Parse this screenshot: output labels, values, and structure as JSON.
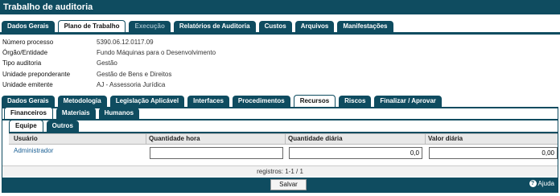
{
  "window": {
    "title": "Trabalho de auditoria"
  },
  "main_tabs": [
    {
      "label": "Dados Gerais",
      "state": "normal"
    },
    {
      "label": "Plano de Trabalho",
      "state": "active"
    },
    {
      "label": "Execução",
      "state": "disabled"
    },
    {
      "label": "Relatórios de Auditoria",
      "state": "normal"
    },
    {
      "label": "Custos",
      "state": "normal"
    },
    {
      "label": "Arquivos",
      "state": "normal"
    },
    {
      "label": "Manifestações",
      "state": "normal"
    }
  ],
  "info": [
    {
      "label": "Número processo",
      "value": "5390.06.12.0117.09"
    },
    {
      "label": "Órgão/Entidade",
      "value": "Fundo Máquinas para o Desenvolvimento"
    },
    {
      "label": "Tipo auditoria",
      "value": "Gestão"
    },
    {
      "label": "Unidade preponderante",
      "value": "Gestão de Bens e Direitos"
    },
    {
      "label": "Unidade emitente",
      "value": "AJ - Assessoria Jurídica"
    }
  ],
  "section_tabs": [
    {
      "label": "Dados Gerais",
      "state": "normal"
    },
    {
      "label": "Metodologia",
      "state": "normal"
    },
    {
      "label": "Legislação Aplicável",
      "state": "normal"
    },
    {
      "label": "Interfaces",
      "state": "normal"
    },
    {
      "label": "Procedimentos",
      "state": "normal"
    },
    {
      "label": "Recursos",
      "state": "active"
    },
    {
      "label": "Riscos",
      "state": "normal"
    },
    {
      "label": "Finalizar / Aprovar",
      "state": "normal"
    }
  ],
  "resource_tabs": [
    {
      "label": "Financeiros",
      "state": "active"
    },
    {
      "label": "Materiais",
      "state": "normal"
    },
    {
      "label": "Humanos",
      "state": "normal"
    }
  ],
  "team_tabs": [
    {
      "label": "Equipe",
      "state": "active"
    },
    {
      "label": "Outros",
      "state": "normal"
    }
  ],
  "table": {
    "headers": [
      "Usuário",
      "Quantidade hora",
      "Quantidade diária",
      "Valor diária"
    ],
    "rows": [
      {
        "usuario": "Administrador",
        "quantidade_hora": "",
        "quantidade_diaria": "0,0",
        "valor_diaria": "0,00"
      }
    ]
  },
  "pagination": {
    "text": "registros: 1-1 / 1"
  },
  "footer": {
    "save_label": "Salvar",
    "help_label": "Ajuda"
  },
  "colors": {
    "primary": "#0f4c60",
    "link": "#1a5f94"
  }
}
